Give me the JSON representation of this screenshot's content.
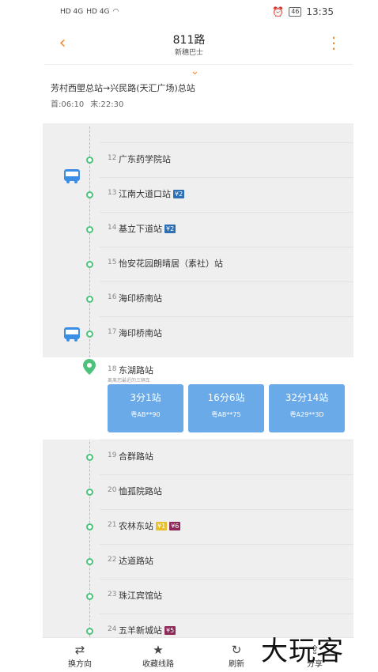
{
  "status_bar": {
    "signal_left": "HD 4G",
    "signal_right": "HD 4G",
    "battery": "46",
    "time": "13:35"
  },
  "header": {
    "title": "811路",
    "subtitle": "新穗巴士"
  },
  "route": {
    "direction": "芳村西塱总站→兴民路(天汇广场)总站",
    "first_bus": "首:06:10",
    "last_bus": "末:22:30"
  },
  "stations_before": [
    {
      "num": "12",
      "name": "广东药学院站",
      "tags": []
    },
    {
      "num": "13",
      "name": "江南大道口站",
      "tags": [
        {
          "text": "¥2",
          "color": "blue"
        }
      ]
    },
    {
      "num": "14",
      "name": "基立下道站",
      "tags": [
        {
          "text": "¥2",
          "color": "blue"
        }
      ]
    },
    {
      "num": "15",
      "name": "怡安花园朗晴居（素社）站",
      "tags": []
    },
    {
      "num": "16",
      "name": "海印桥南站",
      "tags": []
    },
    {
      "num": "17",
      "name": "海印桥南站",
      "tags": []
    }
  ],
  "current_station": {
    "num": "18",
    "name": "东湖路站",
    "hint": "离离您最近的三辆车",
    "arrivals": [
      {
        "eta": "3分1站",
        "plate": "粤AB**90"
      },
      {
        "eta": "16分6站",
        "plate": "粤AB**75"
      },
      {
        "eta": "32分14站",
        "plate": "粤A29**3D"
      }
    ]
  },
  "stations_after": [
    {
      "num": "19",
      "name": "合群路站",
      "tags": []
    },
    {
      "num": "20",
      "name": "恤孤院路站",
      "tags": []
    },
    {
      "num": "21",
      "name": "农林东站",
      "tags": [
        {
          "text": "¥1",
          "color": "yellow"
        },
        {
          "text": "¥6",
          "color": "purple"
        }
      ]
    },
    {
      "num": "22",
      "name": "达道路站",
      "tags": []
    },
    {
      "num": "23",
      "name": "珠江宾馆站",
      "tags": []
    },
    {
      "num": "24",
      "name": "五羊新城站",
      "tags": [
        {
          "text": "¥5",
          "color": "purple"
        }
      ]
    }
  ],
  "bottom_tabs": [
    {
      "label": "换方向",
      "icon": "swap-icon"
    },
    {
      "label": "收藏线路",
      "icon": "star-icon"
    },
    {
      "label": "刷新",
      "icon": "refresh-icon"
    },
    {
      "label": "分享",
      "icon": "share-icon"
    }
  ],
  "watermark": "大玩客",
  "colors": {
    "accent": "#f08c2a",
    "track": "#4cc27a",
    "arrival_card": "#6aaae8"
  }
}
